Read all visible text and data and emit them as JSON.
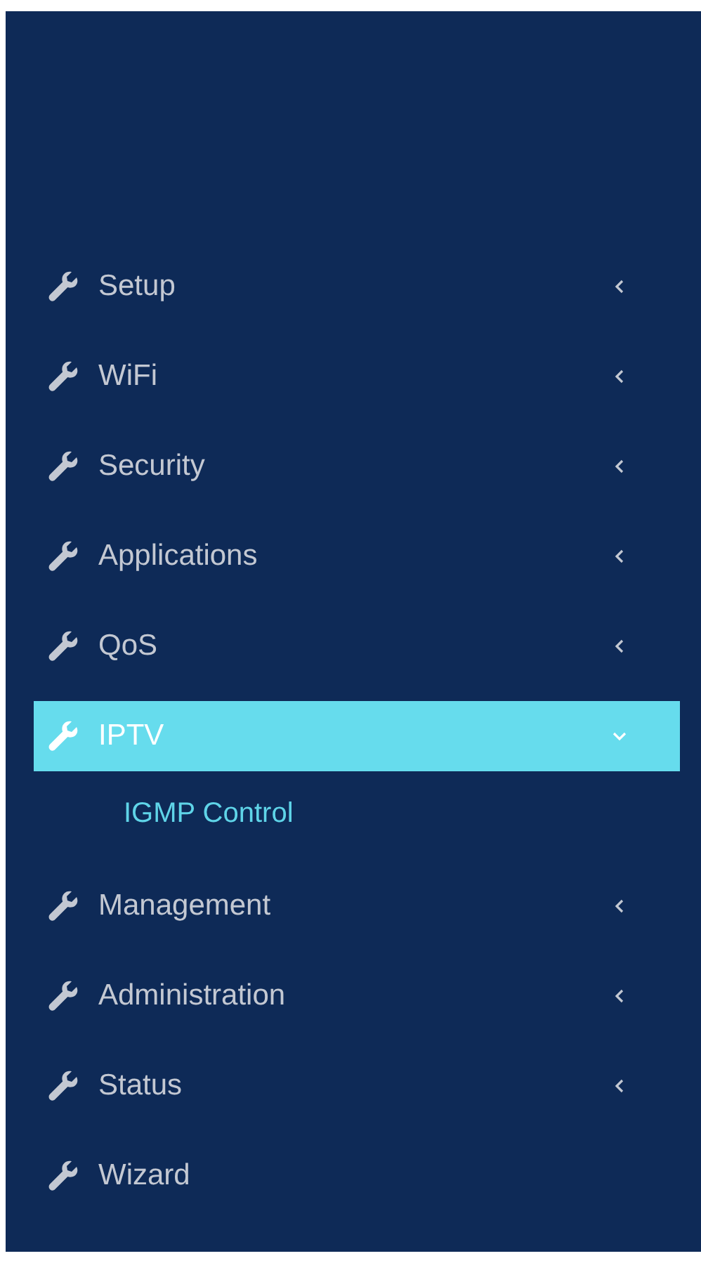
{
  "menu": [
    {
      "label": "Setup",
      "selected": false,
      "expanded": false
    },
    {
      "label": "WiFi",
      "selected": false,
      "expanded": false
    },
    {
      "label": "Security",
      "selected": false,
      "expanded": false
    },
    {
      "label": "Applications",
      "selected": false,
      "expanded": false
    },
    {
      "label": "QoS",
      "selected": false,
      "expanded": false
    },
    {
      "label": "IPTV",
      "selected": true,
      "expanded": true,
      "children": [
        {
          "label": "IGMP Control",
          "selected": true
        }
      ]
    },
    {
      "label": "Management",
      "selected": false,
      "expanded": false
    },
    {
      "label": "Administration",
      "selected": false,
      "expanded": false
    },
    {
      "label": "Status",
      "selected": false,
      "expanded": false
    },
    {
      "label": "Wizard",
      "selected": false
    }
  ]
}
